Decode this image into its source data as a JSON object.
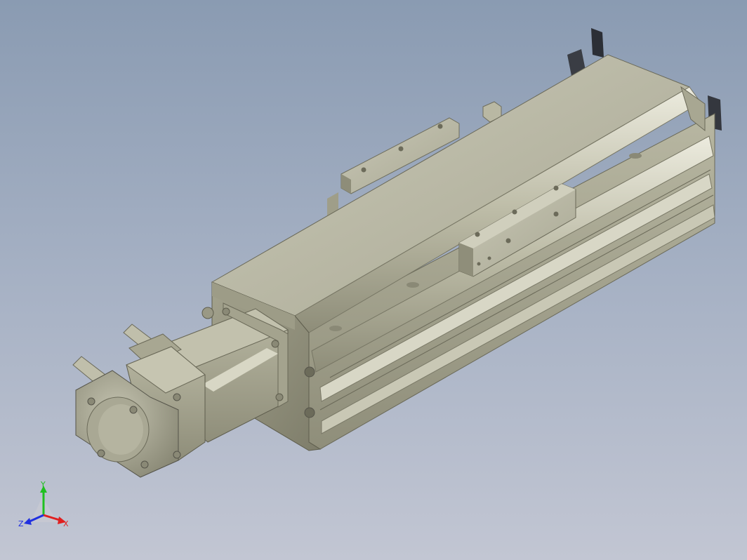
{
  "viewport": {
    "background_top": "#8a9bb2",
    "background_bottom": "#c2c6d3",
    "model_color": "#b3b39f"
  },
  "triad": {
    "x_label": "X",
    "y_label": "Y",
    "z_label": "Z",
    "x_color": "#e02020",
    "y_color": "#20c020",
    "z_color": "#2030e0"
  }
}
